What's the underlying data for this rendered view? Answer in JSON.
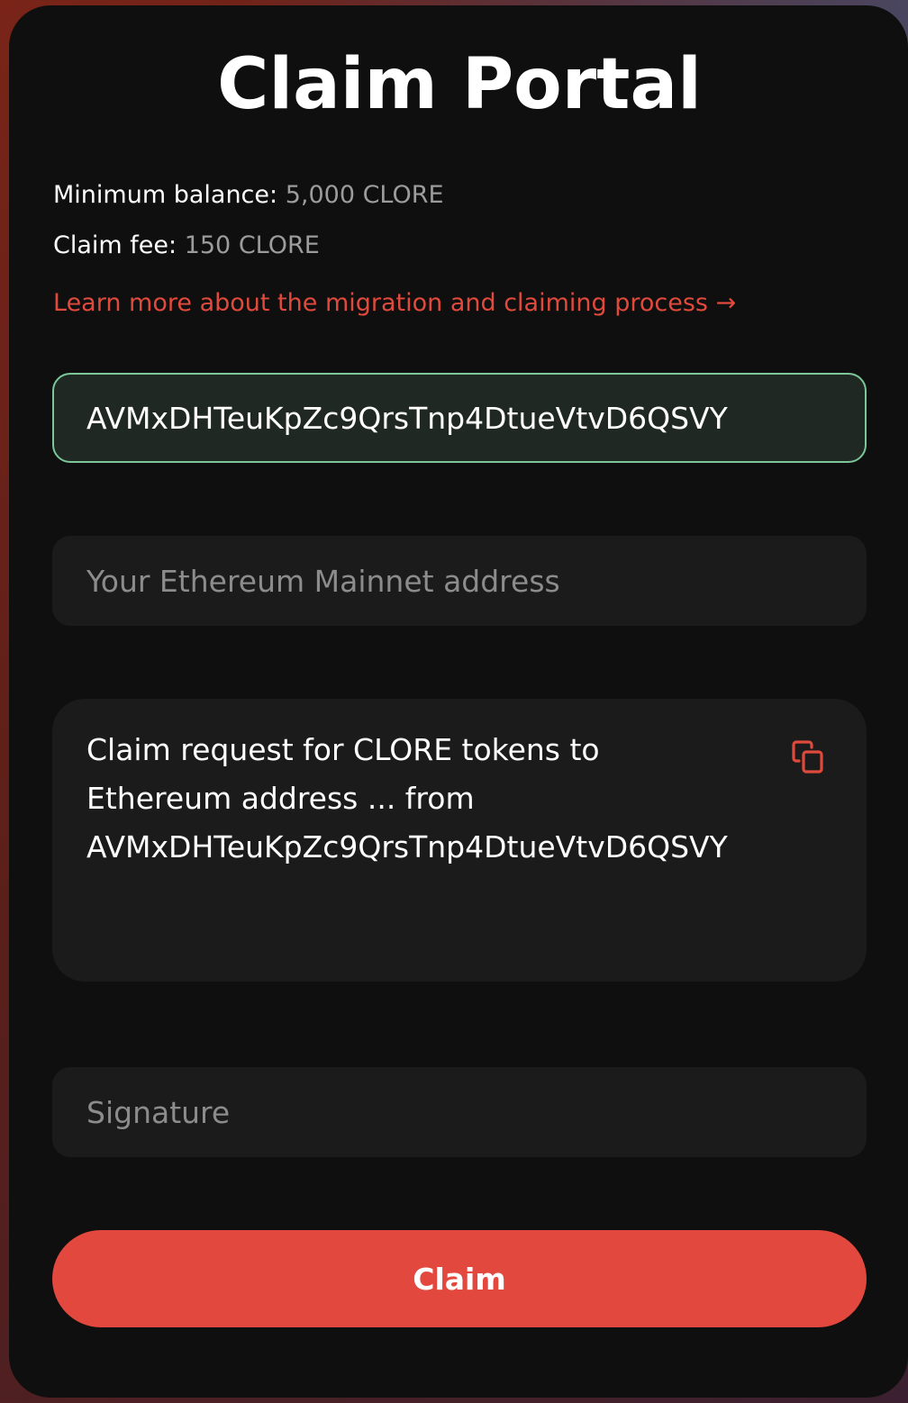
{
  "page": {
    "title": "Claim Portal"
  },
  "info": {
    "min_balance_label": "Minimum balance:",
    "min_balance_value": "5,000 CLORE",
    "claim_fee_label": "Claim fee:",
    "claim_fee_value": "150 CLORE",
    "learn_more_link": "Learn more about the migration and claiming process →"
  },
  "form": {
    "clore_address_value": "AVMxDHTeuKpZc9QrsTnp4DtueVtvD6QSVY",
    "eth_address_placeholder": "Your Ethereum Mainnet address",
    "message_lines": [
      "Claim request for CLORE tokens to",
      "Ethereum address ... from",
      "AVMxDHTeuKpZc9QrsTnp4DtueVtvD6QSVY"
    ],
    "copy_icon": "copy-icon",
    "signature_placeholder": "Signature",
    "claim_button_label": "Claim"
  },
  "colors": {
    "accent": "#e2483e",
    "link": "#e04a3c",
    "active_border": "#7cc79a",
    "card_bg": "#0f0f0f",
    "field_bg": "#1b1b1b"
  }
}
